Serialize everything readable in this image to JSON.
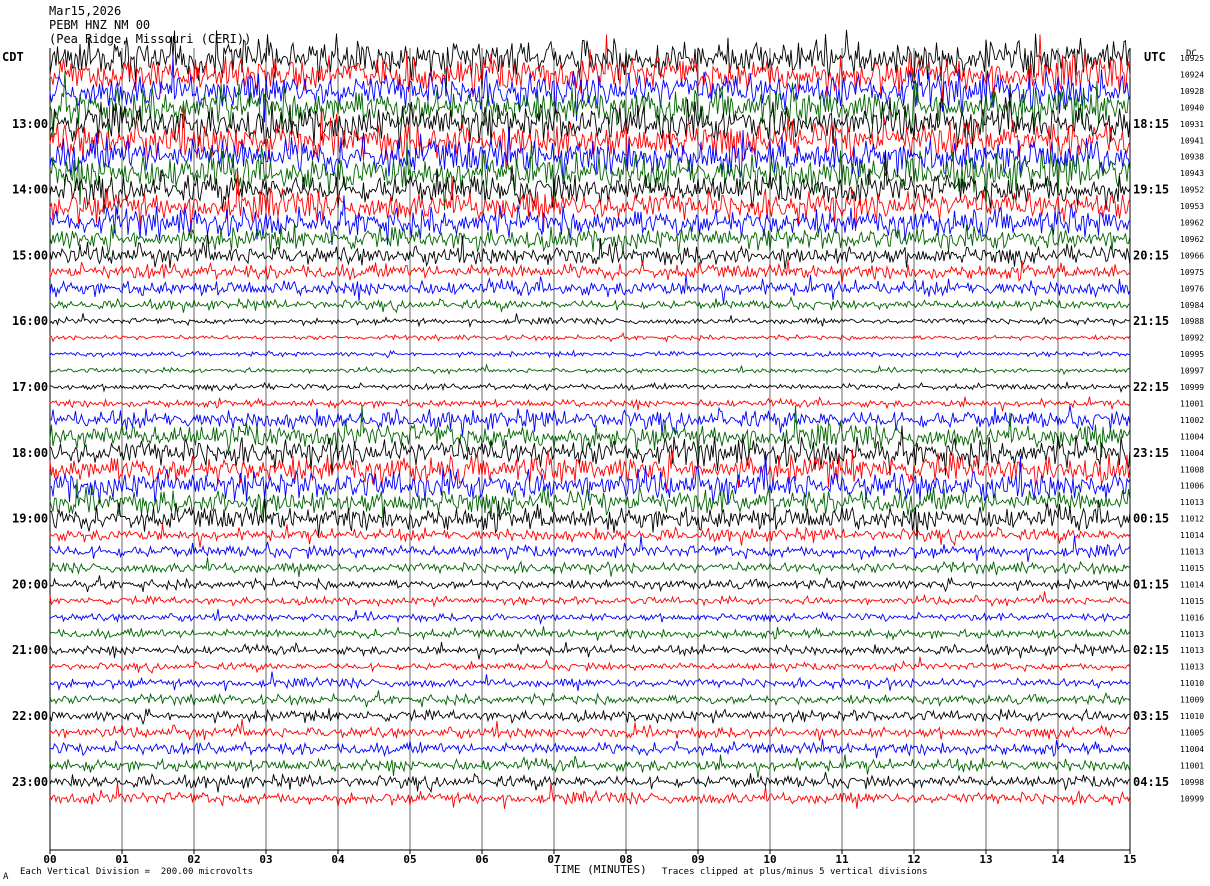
{
  "header": {
    "date": "Mar15,2026",
    "station": "PEBM HNZ NM 00",
    "location": "(Pea Ridge, Missouri (CERI))"
  },
  "left_axis_title": "CDT",
  "right_axis_title": "UTC",
  "dc_title": "DC",
  "footer": {
    "scale_note": "Each Vertical Division =  200.00 microvolts",
    "clip_note": "Traces clipped at plus/minus 5 vertical divisions",
    "corner_mark": "A"
  },
  "colors": {
    "black": "#000000",
    "red": "#ff0000",
    "blue": "#0000ff",
    "green": "#006400"
  },
  "chart_data": {
    "type": "line",
    "title": "",
    "xlabel": "TIME (MINUTES)",
    "ylabel": "",
    "xlim": [
      0,
      15
    ],
    "x_ticks": [
      "00",
      "01",
      "02",
      "03",
      "04",
      "05",
      "06",
      "07",
      "08",
      "09",
      "10",
      "11",
      "12",
      "13",
      "14",
      "15"
    ],
    "trace_color_cycle": [
      "black",
      "red",
      "blue",
      "green"
    ],
    "left_hour_labels": [
      "13:00",
      "14:00",
      "15:00",
      "16:00",
      "17:00",
      "18:00",
      "19:00",
      "20:00",
      "21:00",
      "22:00",
      "23:00"
    ],
    "right_hour_labels": [
      "18:15",
      "19:15",
      "20:15",
      "21:15",
      "22:15",
      "23:15",
      "00:15",
      "01:15",
      "02:15",
      "03:15",
      "04:15"
    ],
    "dc_offsets": [
      "10925",
      "10924",
      "10928",
      "10940",
      "10931",
      "10941",
      "10938",
      "10943",
      "10952",
      "10953",
      "10962",
      "10962",
      "10966",
      "10975",
      "10976",
      "10984",
      "10988",
      "10992",
      "10995",
      "10997",
      "10999",
      "11001",
      "11002",
      "11004",
      "11004",
      "11008",
      "11006",
      "11013",
      "11012",
      "11014",
      "11013",
      "11015",
      "11014",
      "11015",
      "11016",
      "11013",
      "11013",
      "11013",
      "11010",
      "11009",
      "11010",
      "11005",
      "11004",
      "11001",
      "10998",
      "10999"
    ],
    "trace_amplitude": [
      12,
      12,
      12,
      12,
      12,
      12,
      12,
      12,
      10,
      10,
      9,
      7,
      6,
      5,
      5,
      3,
      2,
      1.5,
      1.5,
      1.5,
      2,
      2.5,
      6,
      8,
      9,
      9,
      9,
      8,
      8,
      4,
      4,
      3.5,
      3,
      2.5,
      2.5,
      3,
      3,
      2.5,
      3,
      3,
      3.5,
      3.5,
      4,
      4,
      4,
      4
    ]
  }
}
